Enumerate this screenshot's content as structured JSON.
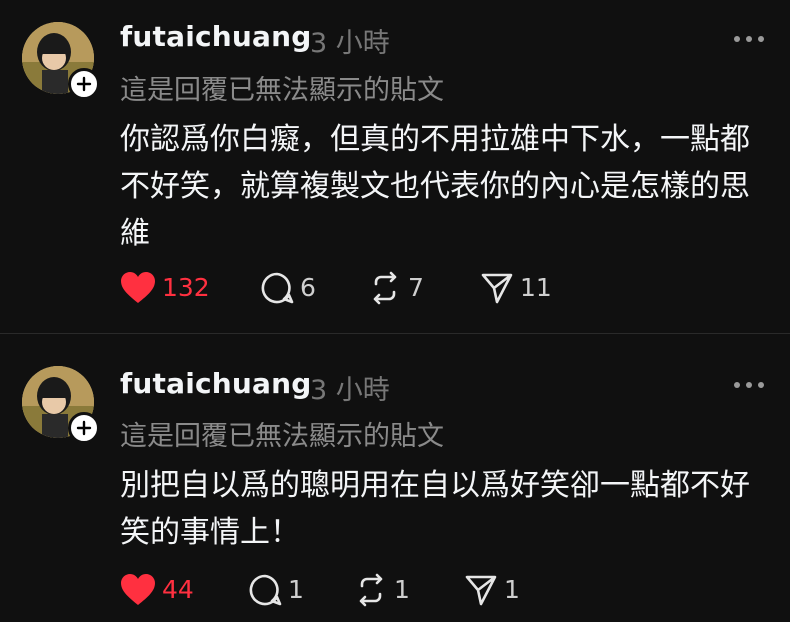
{
  "posts": [
    {
      "username": "futaichuang",
      "time": "3 小時",
      "hidden_note": "這是回覆已無法顯示的貼文",
      "text": "你認爲你白癡，但真的不用拉雄中下水，一點都不好笑，就算複製文也代表你的內心是怎樣的思維",
      "likes": "132",
      "comments": "6",
      "reposts": "7",
      "shares": "11",
      "liked": true
    },
    {
      "username": "futaichuang",
      "time": "3 小時",
      "hidden_note": "這是回覆已無法顯示的貼文",
      "text": "別把自以爲的聰明用在自以爲好笑卻一點都不好笑的事情上！",
      "likes": "44",
      "comments": "1",
      "reposts": "1",
      "shares": "1",
      "liked": true
    }
  ],
  "colors": {
    "background": "#101010",
    "like_red": "#ff3040",
    "muted_text": "#777777"
  },
  "icons": [
    "heart-icon",
    "comment-icon",
    "repost-icon",
    "share-icon",
    "more-icon",
    "plus-icon"
  ]
}
